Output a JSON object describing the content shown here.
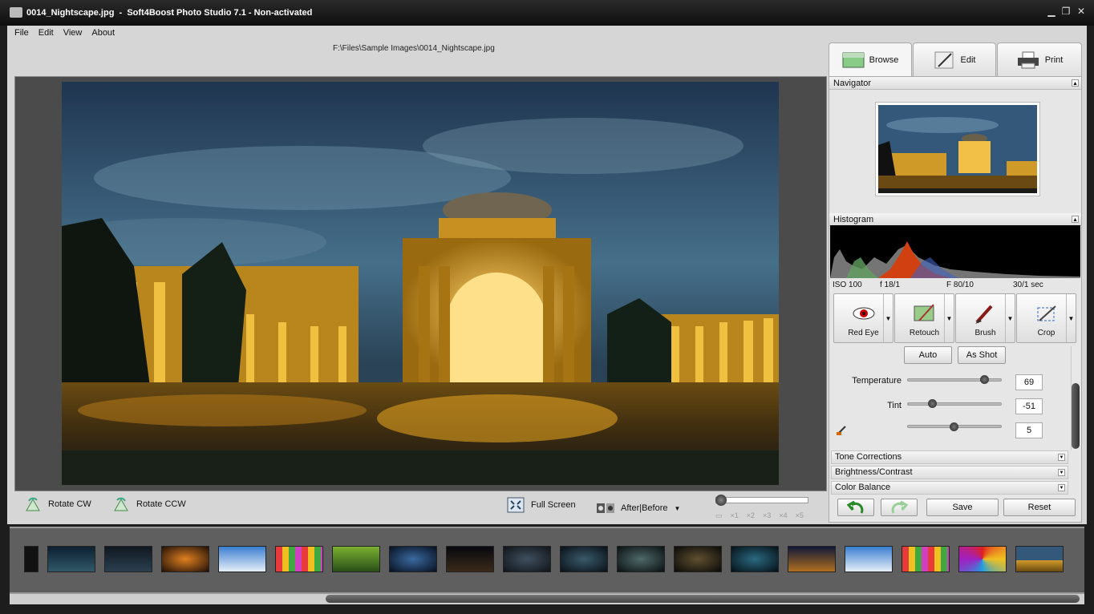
{
  "window": {
    "title": "0014_Nightscape.jpg  -  Soft4Boost Photo Studio 7.1 - Non-activated"
  },
  "menu": [
    "File",
    "Edit",
    "View",
    "About"
  ],
  "file_path": "F:\\Files\\Sample Images\\0014_Nightscape.jpg",
  "tabs": {
    "browse": "Browse",
    "edit": "Edit",
    "print": "Print"
  },
  "navigator": {
    "title": "Navigator"
  },
  "histogram": {
    "title": "Histogram"
  },
  "exif": {
    "iso": "ISO 100",
    "focal": "f 18/1",
    "aperture": "F 80/10",
    "shutter": "30/1 sec"
  },
  "tools": {
    "red_eye": "Red Eye",
    "retouch": "Retouch",
    "brush": "Brush",
    "crop": "Crop"
  },
  "adjust": {
    "auto": "Auto",
    "as_shot": "As Shot",
    "temperature_label": "Temperature",
    "temperature_value": "69",
    "tint_label": "Tint",
    "tint_value": "-51",
    "third_value": "5"
  },
  "sections": [
    "Tone Corrections",
    "Brightness/Contrast",
    "Color Balance"
  ],
  "actions": {
    "save": "Save",
    "reset": "Reset"
  },
  "bottom": {
    "rotate_cw": "Rotate CW",
    "rotate_ccw": "Rotate CCW",
    "full_screen": "Full Screen",
    "after_before": "After|Before"
  },
  "zoom_marks": [
    "×1",
    "×2",
    "×3",
    "×4",
    "×5"
  ]
}
